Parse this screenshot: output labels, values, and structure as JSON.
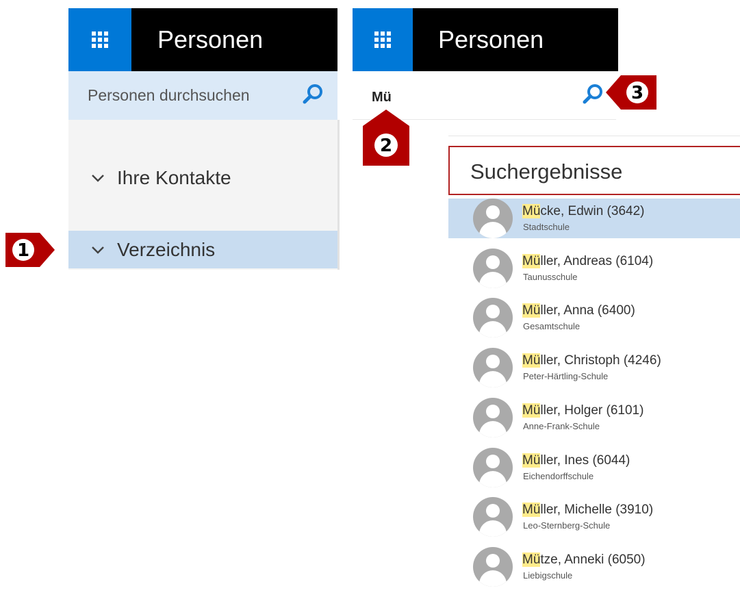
{
  "left": {
    "header_title": "Personen",
    "search_placeholder": "Personen durchsuchen",
    "nav": [
      {
        "label": "Ihre Kontakte",
        "icon": "chevron-down-icon"
      },
      {
        "label": "Verzeichnis",
        "icon": "chevron-down-icon",
        "selected": true
      }
    ]
  },
  "right": {
    "header_title": "Personen",
    "search_value": "Mü",
    "results_heading": "Suchergebnisse",
    "results": [
      {
        "highlight": "Mü",
        "rest": "cke, Edwin (3642)",
        "school": "Stadtschule",
        "selected": true
      },
      {
        "highlight": "Mü",
        "rest": "ller, Andreas (6104)",
        "school": "Taunusschule"
      },
      {
        "highlight": "Mü",
        "rest": "ller, Anna (6400)",
        "school": "Gesamtschule"
      },
      {
        "highlight": "Mü",
        "rest": "ller, Christoph (4246)",
        "school": "Peter-Härtling-Schule"
      },
      {
        "highlight": "Mü",
        "rest": "ller, Holger (6101)",
        "school": "Anne-Frank-Schule"
      },
      {
        "highlight": "Mü",
        "rest": "ller, Ines (6044)",
        "school": "Eichendorffschule"
      },
      {
        "highlight": "Mü",
        "rest": "ller, Michelle (3910)",
        "school": "Leo-Sternberg-Schule"
      },
      {
        "highlight": "Mü",
        "rest": "tze, Anneki (6050)",
        "school": "Liebigschule"
      }
    ]
  },
  "callouts": [
    "1",
    "2",
    "3"
  ],
  "colors": {
    "brand_blue": "#0078d7",
    "header_bg": "#000000",
    "search_bg": "#dbe9f7",
    "selection_bg": "#c8dcf0",
    "highlight": "#ffec8b",
    "callout_red": "#b20000",
    "heading_border": "#b22222"
  }
}
